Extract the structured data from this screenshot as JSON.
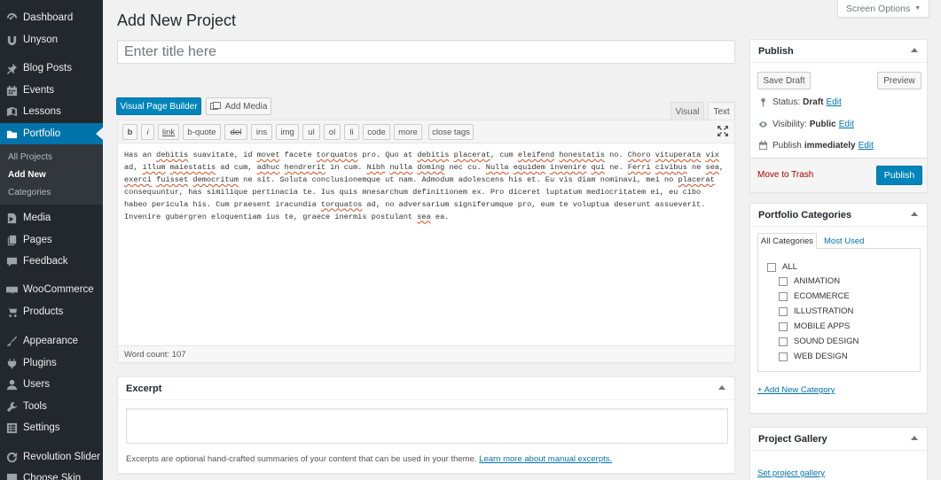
{
  "sidebar": {
    "items": [
      {
        "label": "Dashboard",
        "icon": "dashboard-icon"
      },
      {
        "label": "Unyson",
        "icon": "unyson-icon"
      },
      {
        "label": "Blog Posts",
        "icon": "pin-icon"
      },
      {
        "label": "Events",
        "icon": "calendar-icon"
      },
      {
        "label": "Lessons",
        "icon": "book-icon"
      },
      {
        "label": "Portfolio",
        "icon": "folder-icon"
      },
      {
        "label": "Media",
        "icon": "media-icon"
      },
      {
        "label": "Pages",
        "icon": "pages-icon"
      },
      {
        "label": "Feedback",
        "icon": "comment-icon"
      },
      {
        "label": "WooCommerce",
        "icon": "woocommerce-icon"
      },
      {
        "label": "Products",
        "icon": "cart-icon"
      },
      {
        "label": "Appearance",
        "icon": "brush-icon"
      },
      {
        "label": "Plugins",
        "icon": "plugin-icon"
      },
      {
        "label": "Users",
        "icon": "users-icon"
      },
      {
        "label": "Tools",
        "icon": "wrench-icon"
      },
      {
        "label": "Settings",
        "icon": "settings-icon"
      },
      {
        "label": "Revolution Slider",
        "icon": "refresh-icon"
      },
      {
        "label": "Choose Skin",
        "icon": "skin-icon"
      }
    ],
    "submenu": [
      "All Projects",
      "Add New",
      "Categories"
    ]
  },
  "header": {
    "title": "Add New Project",
    "screen_options": "Screen Options"
  },
  "title_input": {
    "placeholder": "Enter title here",
    "value": ""
  },
  "editor": {
    "visual_builder_label": "Visual Page Builder",
    "add_media_label": "Add Media",
    "tab_visual": "Visual",
    "tab_text": "Text",
    "quicktags": [
      "b",
      "i",
      "link",
      "b-quote",
      "del",
      "ins",
      "img",
      "ul",
      "ol",
      "li",
      "code",
      "more",
      "close tags"
    ],
    "content": "Has an debitis suavitate, id movet facete torquatos pro. Quo at debitis placerat, cum eleifend honestatis no. Choro vituperata vix ad, illum maiestatis ad cum, adhuc hendrerit in cum. Nibh nulla doming nec cu. Nulla equidem invenire qui ne. Ferri civibus ne sea, exerci fuisset democritum ne sit. Soluta conclusionemque ut nam. Admodum adolescens his et. Eu vis diam nominavi, mei no placerat consequuntur, has similique pertinacia te. Ius quis mnesarchum definitionem ex. Pro diceret luptatum mediocritatem ei, eu cibo habeo pericula his. Cum praesent iracundia torquatos ad, no adversarium signiferumque pro, eum te voluptua deserunt assueverit. Invenire gubergren eloquentiam ius te, graece inermis postulant sea ea.",
    "word_count": "Word count: 107"
  },
  "excerpt": {
    "title": "Excerpt",
    "value": "",
    "help": "Excerpts are optional hand-crafted summaries of your content that can be used in your theme.",
    "help_link": "Learn more about manual excerpts."
  },
  "publish": {
    "title": "Publish",
    "save_draft": "Save Draft",
    "preview": "Preview",
    "status_label": "Status:",
    "status_value": "Draft",
    "visibility_label": "Visibility:",
    "visibility_value": "Public",
    "publish_label": "Publish",
    "publish_value": "immediately",
    "edit": "Edit",
    "trash": "Move to Trash",
    "publish_button": "Publish"
  },
  "categories": {
    "title": "Portfolio Categories",
    "tab_all": "All Categories",
    "tab_most": "Most Used",
    "items": [
      "ALL",
      "ANIMATION",
      "ECOMMERCE",
      "ILLUSTRATION",
      "MOBILE APPS",
      "SOUND DESIGN",
      "WEB DESIGN"
    ],
    "add_new": "+ Add New Category"
  },
  "gallery": {
    "title": "Project Gallery",
    "set_link": "Set project gallery"
  },
  "colors": {
    "accent": "#0073aa",
    "sidebar_bg": "#23282d",
    "button_primary": "#0085ba",
    "trash": "#aa0000"
  }
}
